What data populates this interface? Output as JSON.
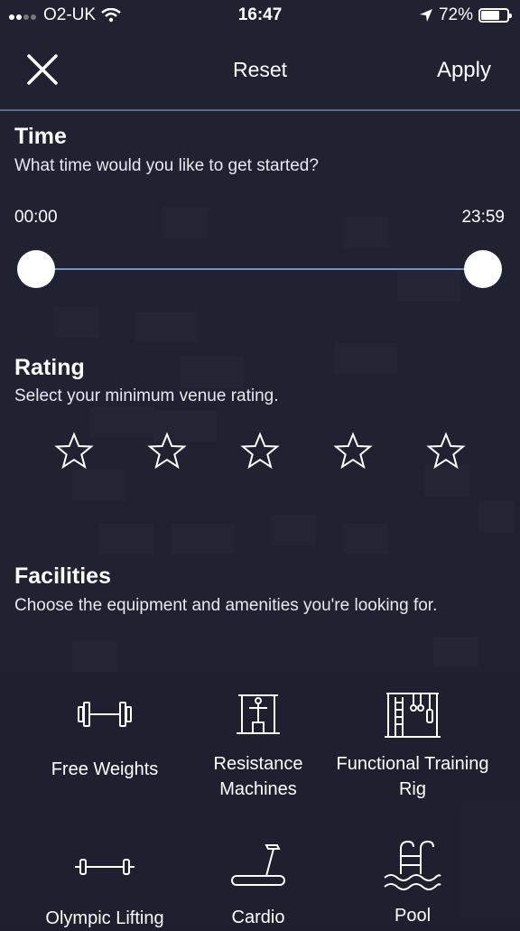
{
  "status_bar": {
    "carrier": "O2-UK",
    "time": "16:47",
    "battery_percent": "72%",
    "battery_level": 0.72
  },
  "header": {
    "reset_label": "Reset",
    "apply_label": "Apply"
  },
  "time_section": {
    "title": "Time",
    "subtitle": "What time would you like to get started?",
    "min_label": "00:00",
    "max_label": "23:59"
  },
  "rating_section": {
    "title": "Rating",
    "subtitle": "Select your minimum venue rating.",
    "stars": 5,
    "selected": 0
  },
  "facilities_section": {
    "title": "Facilities",
    "subtitle": "Choose the equipment and amenities you're looking for.",
    "items": [
      {
        "label": "Free Weights",
        "icon": "dumbbell-icon"
      },
      {
        "label": "Resistance Machines",
        "icon": "resistance-machine-icon"
      },
      {
        "label": "Functional Training Rig",
        "icon": "training-rig-icon"
      },
      {
        "label": "Olympic Lifting",
        "icon": "barbell-icon"
      },
      {
        "label": "Cardio",
        "icon": "treadmill-icon"
      },
      {
        "label": "Pool",
        "icon": "pool-icon"
      }
    ]
  },
  "colors": {
    "background": "#1e1f2e",
    "accent_line": "#7d90c4"
  }
}
